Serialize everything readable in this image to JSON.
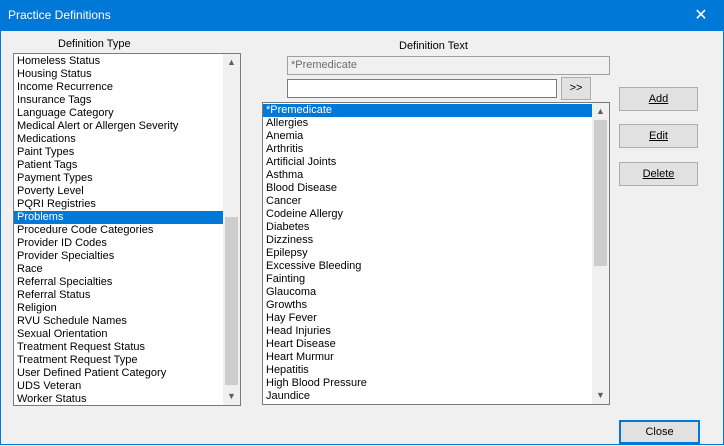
{
  "window": {
    "title": "Practice Definitions",
    "close_glyph": "✕"
  },
  "definition_type": {
    "label": "Definition Type",
    "items": [
      "Homeless Status",
      "Housing Status",
      "Income Recurrence",
      "Insurance Tags",
      "Language Category",
      "Medical Alert or Allergen Severity",
      "Medications",
      "Paint Types",
      "Patient Tags",
      "Payment Types",
      "Poverty Level",
      "PQRI Registries",
      "Problems",
      "Procedure Code Categories",
      "Provider ID Codes",
      "Provider Specialties",
      "Race",
      "Referral Specialties",
      "Referral Status",
      "Religion",
      "RVU Schedule Names",
      "Sexual Orientation",
      "Treatment Request Status",
      "Treatment Request Type",
      "User Defined Patient Category",
      "UDS Veteran",
      "Worker Status"
    ],
    "selected": "Problems"
  },
  "definition_text": {
    "label": "Definition Text",
    "current_value": "*Premedicate",
    "input_value": "",
    "move_button": ">>",
    "items": [
      "*Premedicate",
      "Allergies",
      "Anemia",
      "Arthritis",
      "Artificial Joints",
      "Asthma",
      "Blood Disease",
      "Cancer",
      "Codeine Allergy",
      "Diabetes",
      "Dizziness",
      "Epilepsy",
      "Excessive Bleeding",
      "Fainting",
      "Glaucoma",
      "Growths",
      "Hay Fever",
      "Head Injuries",
      "Heart Disease",
      "Heart Murmur",
      "Hepatitis",
      "High Blood Pressure",
      "Jaundice"
    ],
    "selected": "*Premedicate"
  },
  "buttons": {
    "add": "Add",
    "edit": "Edit",
    "delete": "Delete",
    "close": "Close"
  },
  "icons": {
    "scroll_up": "▲",
    "scroll_down": "▼"
  }
}
